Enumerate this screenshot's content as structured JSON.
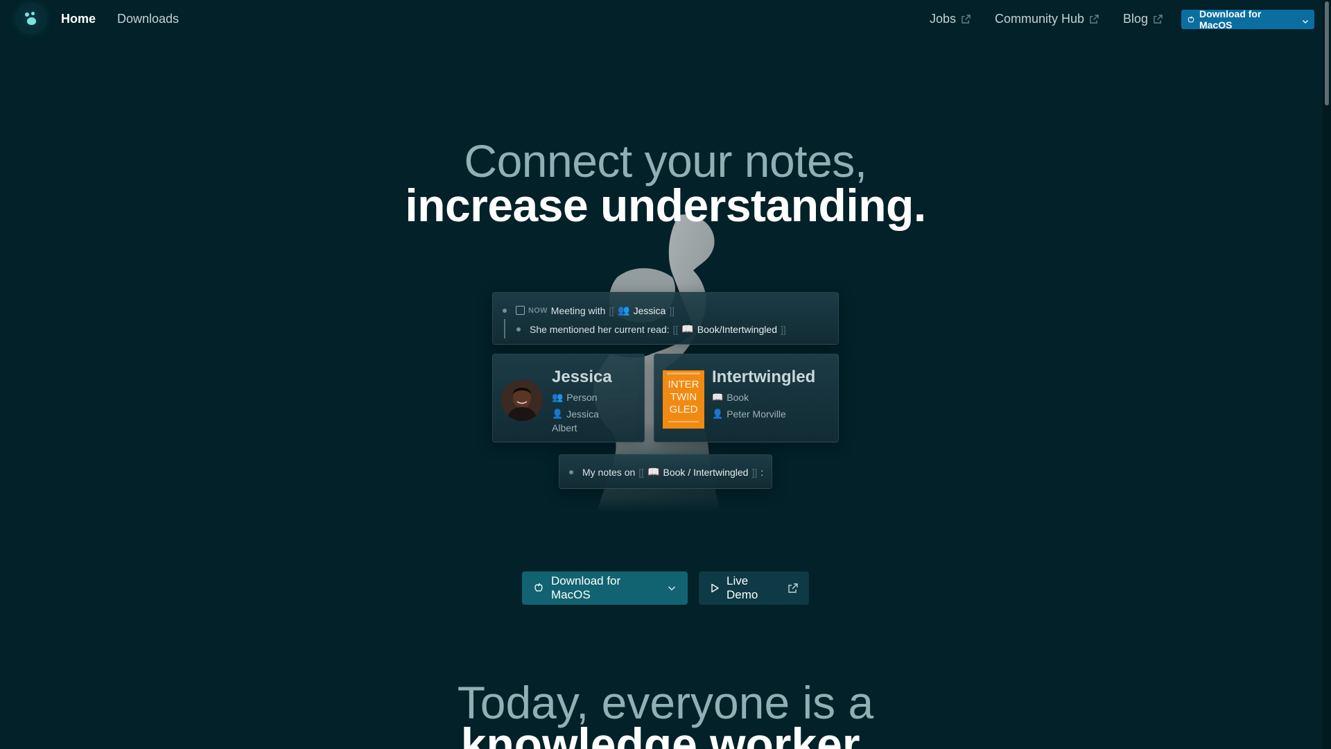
{
  "nav": {
    "logo_icon": "logseq-logo-icon",
    "home": "Home",
    "downloads": "Downloads",
    "jobs": "Jobs",
    "community": "Community Hub",
    "blog": "Blog",
    "download_btn": "Download for MacOS"
  },
  "hero": {
    "line1": "Connect your notes,",
    "line2": "increase understanding."
  },
  "demo": {
    "meeting": {
      "now": "NOW",
      "text": "Meeting with",
      "open": "[[",
      "close": "]]",
      "person_icon": "👥",
      "person": "Jessica"
    },
    "mention": {
      "text": "She mentioned her current read:",
      "open": "[[",
      "close": "]]",
      "book_icon": "📖",
      "book": "Book/Intertwingled"
    },
    "jessica_card": {
      "title": "Jessica",
      "type_icon": "👥",
      "type": "Person",
      "name_icon": "👤",
      "name_line1": "Jessica",
      "name_line2": "Albert"
    },
    "book_card": {
      "title": "Intertwingled",
      "type_icon": "📖",
      "type": "Book",
      "author_icon": "👤",
      "author": "Peter Morville",
      "cover_line1": "INTER",
      "cover_line2": "TWIN",
      "cover_line3": "GLED"
    },
    "notes": {
      "text": "My notes on",
      "open": "[[",
      "book_icon": "📖",
      "book": "Book / Intertwingled",
      "close": "]]",
      "colon": ":"
    }
  },
  "cta": {
    "download": "Download for MacOS",
    "demo": "Live Demo"
  },
  "section2": {
    "line1": "Today, everyone is a",
    "line2": "knowledge worker."
  },
  "colors": {
    "background": "#022129",
    "accent": "#0a6fa0",
    "cta_primary": "#126372"
  }
}
